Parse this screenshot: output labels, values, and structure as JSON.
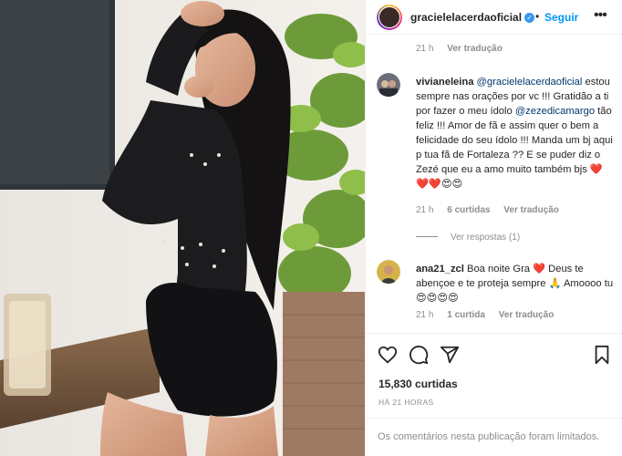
{
  "post": {
    "author": "gracielelacerdaoficial",
    "verified_icon": "verified-badge-icon",
    "separator": "•",
    "follow_label": "Seguir",
    "more_label": "•••",
    "top_meta": {
      "time": "21 h",
      "translate": "Ver tradução"
    }
  },
  "comments": [
    {
      "user": "vivianeleina",
      "mention": "@gracielelacerdaoficial",
      "text_a": " estou sempre nas orações por vc !!! Gratidão a ti por fazer o meu ídolo ",
      "mention2": "@zezedicamargo",
      "text_b": " tão feliz !!! Amor de fã e assim quer o bem a felicidade do seu ídolo !!! Manda um bj aqui p tua fã de Fortaleza ?? E se puder diz o Zezé que eu a amo muito também bjs ❤️❤️❤️😍😍",
      "time": "21 h",
      "likes": "6 curtidas",
      "translate": "Ver tradução",
      "replies": "Ver respostas (1)"
    },
    {
      "user": "ana21_zcl",
      "text": " Boa noite Gra ❤️ Deus te abençoe e te proteja sempre 🙏 Amoooo tu 😍😍😍😍",
      "time": "21 h",
      "likes": "1 curtida",
      "translate": "Ver tradução"
    }
  ],
  "actions": {
    "like_icon": "heart-icon",
    "comment_icon": "comment-icon",
    "share_icon": "share-icon",
    "save_icon": "bookmark-icon"
  },
  "likes_count": "15,830 curtidas",
  "posted_ago": "HÁ 21 HORAS",
  "comments_limited": "Os comentários nesta publicação foram limitados.",
  "colors": {
    "link": "#0095f6",
    "mention": "#00376b",
    "muted": "#8e8e8e",
    "text": "#262626"
  }
}
